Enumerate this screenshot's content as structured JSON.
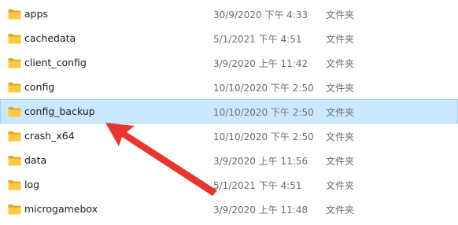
{
  "files": [
    {
      "name": "apps",
      "date": "30/9/2020 下午 4:33",
      "type": "文件夹",
      "selected": false
    },
    {
      "name": "cachedata",
      "date": "5/1/2021 下午 4:51",
      "type": "文件夹",
      "selected": false
    },
    {
      "name": "client_config",
      "date": "3/9/2020 上午 11:42",
      "type": "文件夹",
      "selected": false
    },
    {
      "name": "config",
      "date": "10/10/2020 下午 2:50",
      "type": "文件夹",
      "selected": false
    },
    {
      "name": "config_backup",
      "date": "10/10/2020 下午 2:50",
      "type": "文件夹",
      "selected": true
    },
    {
      "name": "crash_x64",
      "date": "10/10/2020 下午 2:50",
      "type": "文件夹",
      "selected": false
    },
    {
      "name": "data",
      "date": "3/9/2020 上午 11:56",
      "type": "文件夹",
      "selected": false
    },
    {
      "name": "log",
      "date": "5/1/2021 下午 4:51",
      "type": "文件夹",
      "selected": false
    },
    {
      "name": "microgamebox",
      "date": "3/9/2020 上午 11:48",
      "type": "文件夹",
      "selected": false
    }
  ],
  "icons": {
    "folder": "folder-icon",
    "annotation": "red-arrow"
  },
  "colors": {
    "selection_bg": "#cce8ff",
    "selection_border": "#99d1ff",
    "folder": "#ffc83d",
    "arrow": "#e8352f"
  }
}
